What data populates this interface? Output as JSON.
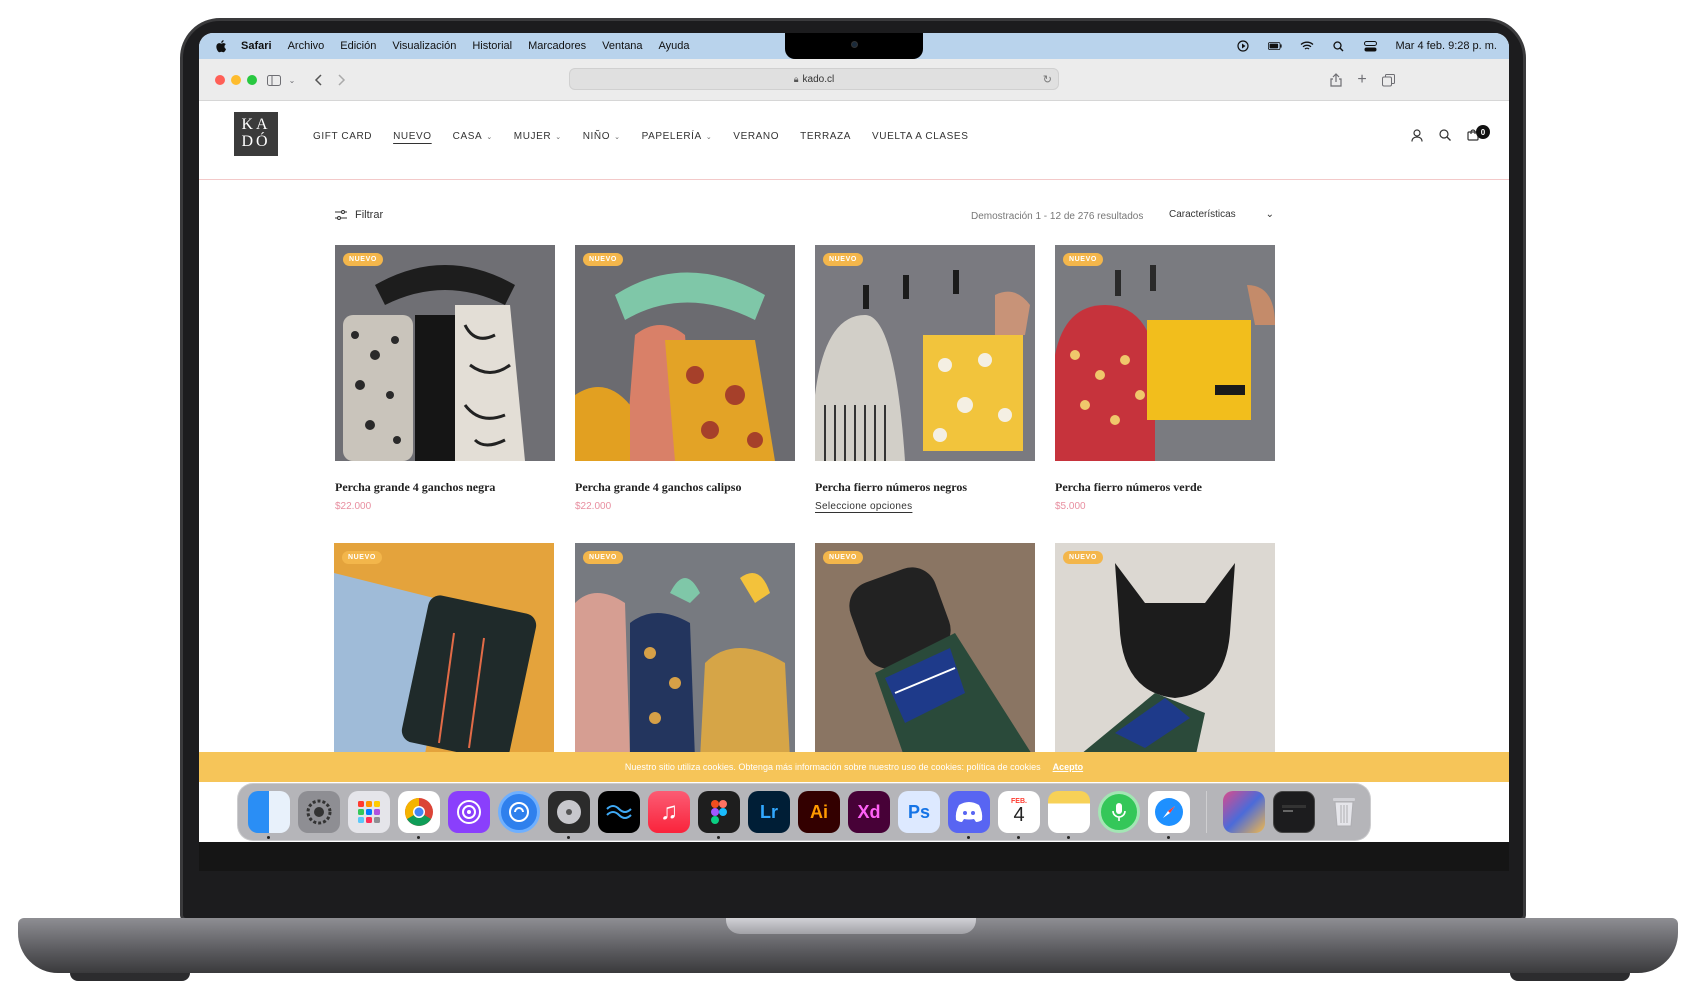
{
  "menubar": {
    "app_name": "Safari",
    "menus": [
      "Archivo",
      "Edición",
      "Visualización",
      "Historial",
      "Marcadores",
      "Ventana",
      "Ayuda"
    ],
    "clock": "Mar 4 feb.  9:28 p. m."
  },
  "browser": {
    "url": "kado.cl"
  },
  "site": {
    "logo_line1": "KA",
    "logo_line2": "DÓ",
    "nav": [
      {
        "label": "GIFT CARD",
        "has_caret": false,
        "active": false
      },
      {
        "label": "NUEVO",
        "has_caret": false,
        "active": true
      },
      {
        "label": "CASA",
        "has_caret": true,
        "active": false
      },
      {
        "label": "MUJER",
        "has_caret": true,
        "active": false
      },
      {
        "label": "NIÑO",
        "has_caret": true,
        "active": false
      },
      {
        "label": "PAPELERÍA",
        "has_caret": true,
        "active": false
      },
      {
        "label": "VERANO",
        "has_caret": false,
        "active": false
      },
      {
        "label": "TERRAZA",
        "has_caret": false,
        "active": false
      },
      {
        "label": "VUELTA A CLASES",
        "has_caret": false,
        "active": false
      }
    ],
    "cart_count": "0"
  },
  "toolbar": {
    "filter_label": "Filtrar",
    "results_text": "Demostración 1 - 12 de 276 resultados",
    "sort_value": "Características"
  },
  "products": [
    {
      "name": "Percha grande 4 ganchos negra",
      "price": "$22.000",
      "badge": "NUEVO"
    },
    {
      "name": "Percha grande 4 ganchos calipso",
      "price": "$22.000",
      "badge": "NUEVO"
    },
    {
      "name": "Percha fierro números negros",
      "link": "Seleccione opciones",
      "badge": "NUEVO"
    },
    {
      "name": "Percha fierro números verde",
      "price": "$5.000",
      "badge": "NUEVO"
    },
    {
      "badge": "NUEVO"
    },
    {
      "badge": "NUEVO"
    },
    {
      "badge": "NUEVO"
    },
    {
      "badge": "NUEVO"
    }
  ],
  "cookie": {
    "text": "Nuestro sitio utiliza cookies. Obtenga más información sobre nuestro uso de cookies: política de cookies",
    "accept": "Acepto"
  },
  "dock": {
    "calendar_month": "FEB.",
    "calendar_day": "4",
    "apps": [
      "finder-icon",
      "system-settings-icon",
      "launchpad-icon",
      "chrome-icon",
      "podcasts-icon",
      "music-app-icon",
      "disk-icon",
      "wave-icon",
      "apple-music-icon",
      "figma-icon",
      "lightroom-icon",
      "illustrator-icon",
      "xd-icon",
      "photoshop-icon",
      "discord-icon",
      "calendar-icon",
      "notes-icon",
      "mic-icon",
      "safari-icon",
      "image-icon",
      "terminal-icon",
      "trash-icon"
    ],
    "labels": {
      "lr": "Lr",
      "ai": "Ai",
      "xd": "Xd",
      "ps": "Ps"
    }
  },
  "colors": {
    "accent_badge": "#f3b64b",
    "price": "#e88fa0",
    "cookie_bar": "#f6c559",
    "menubar": "#b9d3ec"
  }
}
